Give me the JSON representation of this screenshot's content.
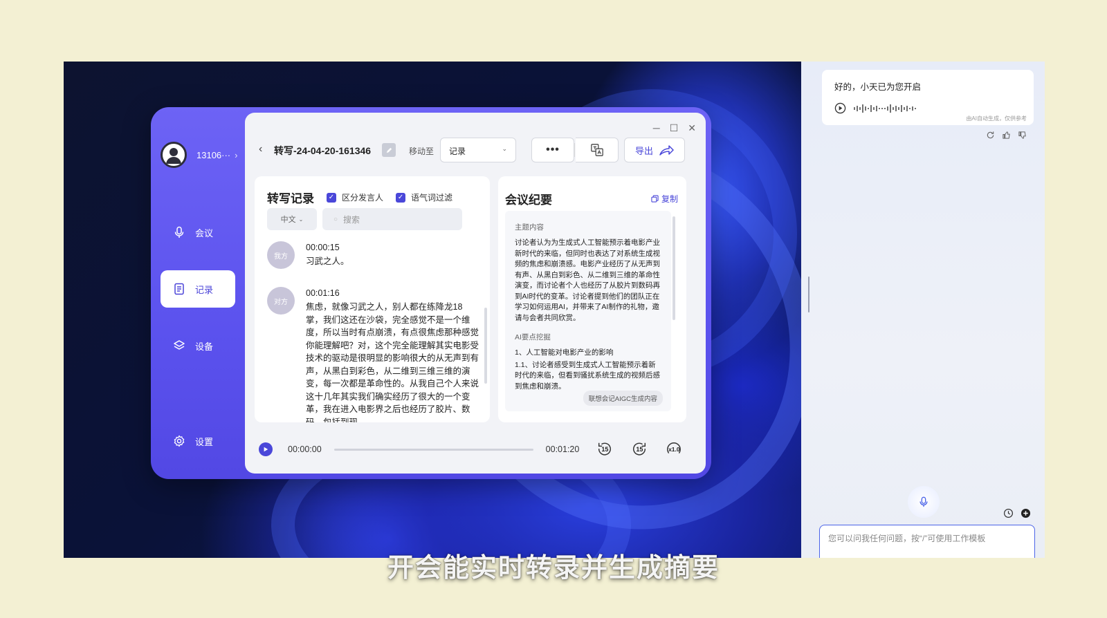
{
  "app": {
    "user": {
      "name": "13106···"
    },
    "nav": [
      {
        "label": "会议",
        "icon": "mic-icon"
      },
      {
        "label": "记录",
        "icon": "document-icon",
        "active": true
      },
      {
        "label": "设备",
        "icon": "layers-icon"
      },
      {
        "label": "设置",
        "icon": "gear-icon"
      }
    ],
    "toolbar": {
      "title": "转写-24-04-20-161346",
      "move_to_label": "移动至",
      "folder_value": "记录",
      "export_label": "导出"
    },
    "transcript": {
      "heading": "转写记录",
      "option_speakers": "区分发言人",
      "option_filler": "语气词过滤",
      "language": "中文",
      "search_placeholder": "搜索",
      "entries": [
        {
          "speaker": "我方",
          "time": "00:00:15",
          "text": "习武之人。"
        },
        {
          "speaker": "对方",
          "time": "00:01:16",
          "text": "焦虑，就像习武之人，别人都在练降龙18掌，我们这还在沙袋，完全感觉不是一个维度，所以当时有点崩溃，有点很焦虑那种感觉你能理解吧？对，这个完全能理解其实电影受技术的驱动是很明显的影响很大的从无声到有声，从黑白到彩色，从二维到三维三维的演变，每一次都是革命性的。从我自己个人来说这十几年其实我们确实经历了很大的一个变革，我在进入电影界之后也经历了胶片、数码，包括到现"
        }
      ]
    },
    "summary": {
      "heading": "会议纪要",
      "copy_label": "复制",
      "topic_label": "主题内容",
      "topic_text": "讨论者认为为生成式人工智能预示着电影产业新时代的来临，但同时也表达了对系统生成视频的焦虑和崩溃感。电影产业经历了从无声到有声、从黑白到彩色、从二维到三维的革命性演变，而讨论者个人也经历了从胶片到数码再到AI时代的变革。讨论者提到他们的团队正在学习如何运用AI，并带来了AI制作的礼物，邀请与会者共同欣赏。",
      "points_label": "AI要点挖掘",
      "point_1": "1、人工智能对电影产业的影响",
      "point_1_1": "1.1、讨论者感受到生成式人工智能预示着新时代的来临，但看到骚扰系统生成的视频后感到焦虑和崩溃。",
      "aigc_button": "联想会记AIGC生成内容"
    },
    "player": {
      "current_time": "00:00:00",
      "duration": "00:01:20",
      "progress": 0,
      "rewind_label": "15",
      "forward_label": "15",
      "speed_label": "x1.0"
    }
  },
  "assistant": {
    "message": "好的，小天已为您开启",
    "ai_note": "由AI自动生成，仅供参考",
    "input_placeholder": "您可以问我任何问题，按“/”可使用工作模板"
  },
  "caption": "开会能实时转录并生成摘要",
  "colors": {
    "accent": "#4a47d9",
    "sidebar": "#5b52ee",
    "page_bg": "#f3f0d3"
  }
}
